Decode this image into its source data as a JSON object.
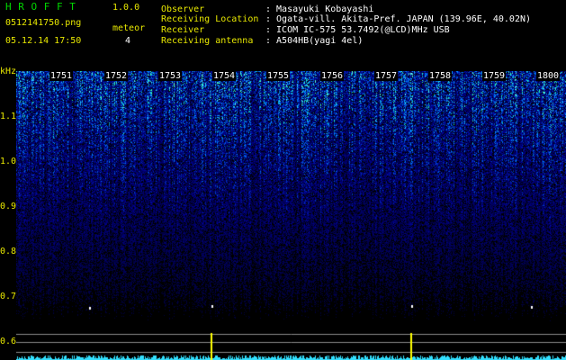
{
  "app": {
    "title": "H R O F F T",
    "version": "1.0.0"
  },
  "file": {
    "name": "0512141750.png",
    "datetime": "05.12.14 17:50"
  },
  "meteor": {
    "label": "meteor",
    "count": "4"
  },
  "info": [
    {
      "label": "Observer",
      "value": ": Masayuki Kobayashi"
    },
    {
      "label": "Receiving Location",
      "value": ": Ogata-vill. Akita-Pref. JAPAN (139.96E, 40.02N)"
    },
    {
      "label": "Receiver",
      "value": ": ICOM IC-575 53.7492(@LCD)MHz USB"
    },
    {
      "label": "Receiving antenna",
      "value": ": A504HB(yagi 4el)"
    }
  ],
  "axis": {
    "unit": "kHz",
    "y_ticks": [
      "1.1",
      "1.0",
      "0.9",
      "0.8",
      "0.7",
      "0.6"
    ],
    "time_marks": [
      "1751",
      "1752",
      "1753",
      "1754",
      "1755",
      "1756",
      "1757",
      "1758",
      "1759",
      "1800"
    ]
  },
  "colors": {
    "background": "#000000",
    "label": "#e8e800",
    "app_title": "#00d800",
    "marker": "#ffffff",
    "baseline": "#33e0ff"
  },
  "meteor_events": [
    {
      "time_minute": 3.3,
      "freq_khz": 0.7
    },
    {
      "time_minute": 6.9,
      "freq_khz": 0.7
    },
    {
      "time_minute": 2.7,
      "freq_khz": 0.7
    },
    {
      "time_minute": 9.4,
      "freq_khz": 0.7
    }
  ]
}
